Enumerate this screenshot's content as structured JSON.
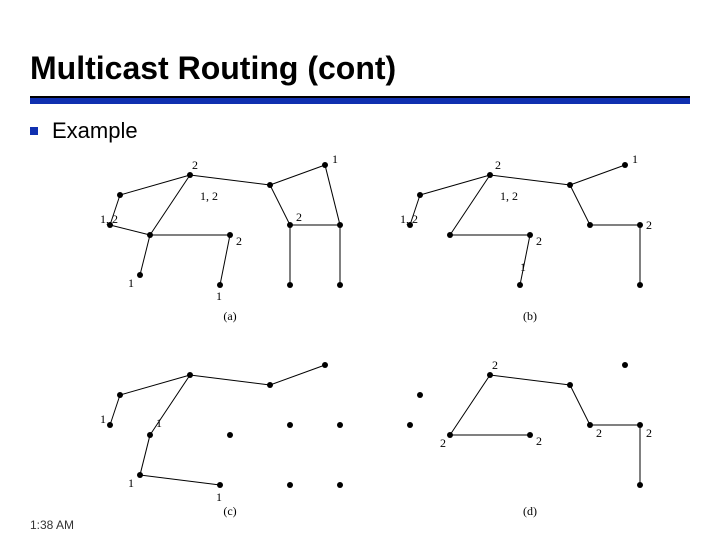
{
  "title": "Multicast Routing (cont)",
  "bullet": "Example",
  "timestamp": "1:38 AM",
  "captions": {
    "a": "(a)",
    "b": "(b)",
    "c": "(c)",
    "d": "(d)"
  },
  "labels": {
    "a": {
      "top_right": "1",
      "mid_left": "2",
      "upper_mid": "1, 2",
      "left_pair": "1, 2",
      "bottom_left": "1",
      "center": "2",
      "right_node": "2",
      "lower_center": "1"
    },
    "b": {
      "top_right": "1",
      "mid_left": "2",
      "upper_mid": "1, 2",
      "left_pair": "1, 2",
      "center": "2",
      "far_right": "2",
      "lower": "1"
    },
    "c": {
      "left_upper": "1",
      "mid": "1",
      "lower_left": "1",
      "bottom": "1"
    },
    "d": {
      "left": "2",
      "mid_top": "2",
      "mid": "2",
      "right_a": "2",
      "right_b": "2"
    }
  }
}
